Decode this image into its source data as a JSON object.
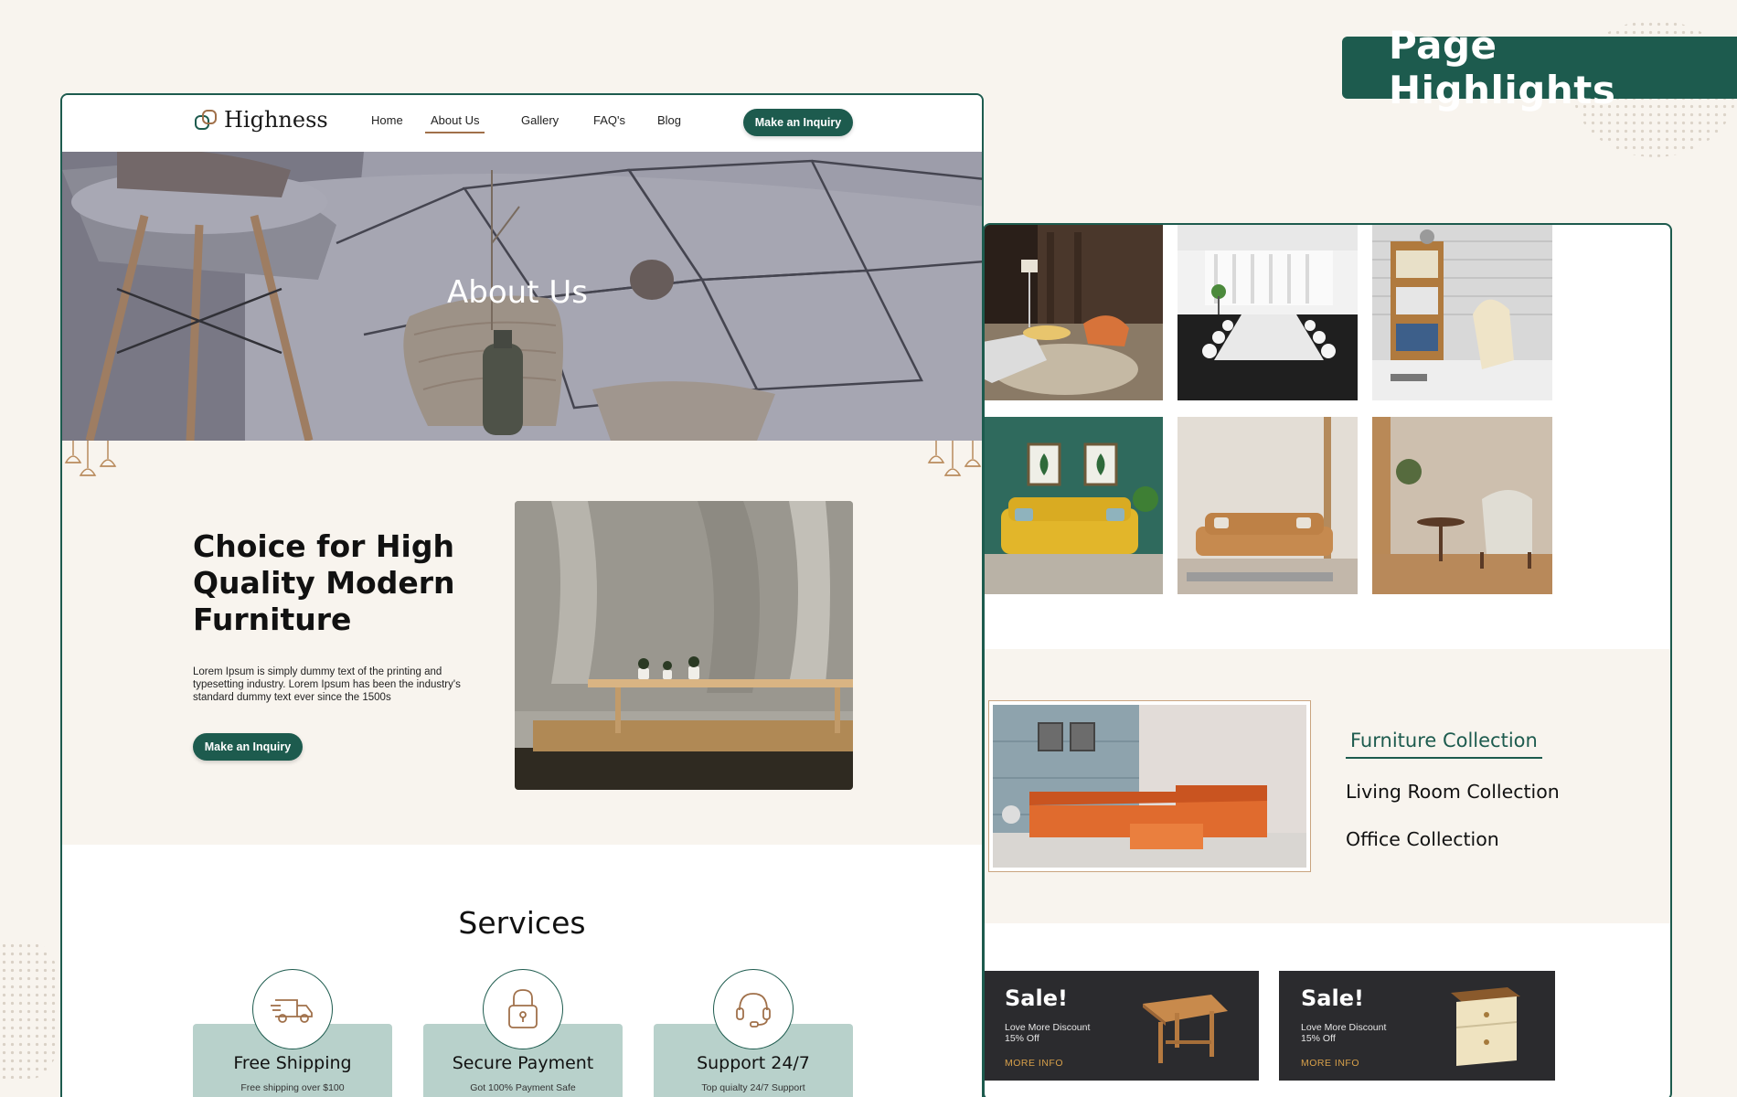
{
  "badge": {
    "title": "Page Highlights"
  },
  "nav": {
    "logo": "Highness",
    "items": [
      "Home",
      "About Us",
      "Gallery",
      "FAQ's",
      "Blog"
    ],
    "active": "About Us",
    "cta": "Make an Inquiry"
  },
  "hero": {
    "title": "About Us"
  },
  "about": {
    "heading": "Choice for High Quality Modern Furniture",
    "body": "Lorem Ipsum is simply dummy text of the printing and typesetting industry. Lorem Ipsum has been the industry's standard dummy text ever since the 1500s",
    "cta": "Make an Inquiry"
  },
  "services": {
    "title": "Services",
    "items": [
      {
        "title": "Free Shipping",
        "sub": "Free shipping over $100",
        "icon": "truck-icon"
      },
      {
        "title": "Secure Payment",
        "sub": "Got 100% Payment Safe",
        "icon": "lock-icon"
      },
      {
        "title": "Support 24/7",
        "sub": "Top quialty 24/7 Support",
        "icon": "headset-icon"
      }
    ]
  },
  "collection": {
    "title": "Furniture Collection",
    "items": [
      "Living Room Collection",
      "Office Collection"
    ]
  },
  "sales": [
    {
      "title": "Sale!",
      "line1": "Love More Discount",
      "line2": "15% Off",
      "link": "MORE INFO"
    },
    {
      "title": "Sale!",
      "line1": "Love More Discount",
      "line2": "15% Off",
      "link": "MORE INFO"
    }
  ],
  "colors": {
    "accent": "#1d5b4e",
    "cream": "#f8f4ee",
    "service_card": "#b8d1cb",
    "sale_bg": "#2b2b2e",
    "sale_link": "#d7a04a"
  }
}
